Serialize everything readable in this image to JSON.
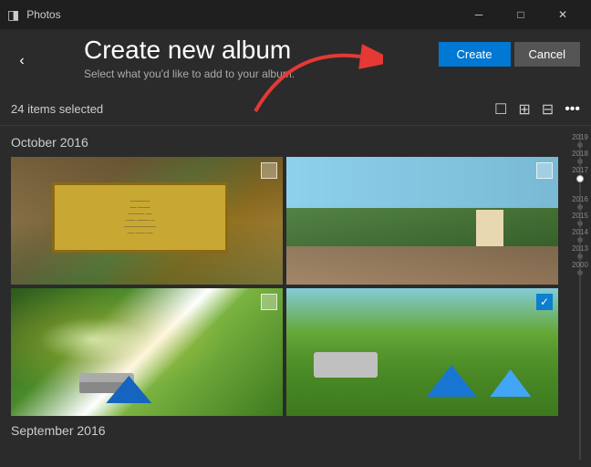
{
  "titlebar": {
    "app_name": "Photos",
    "minimize_label": "─",
    "maximize_label": "□",
    "close_label": "✕"
  },
  "header": {
    "title": "Create new album",
    "subtitle": "Select what you'd like to add to your album.",
    "create_button": "Create",
    "cancel_button": "Cancel"
  },
  "toolbar": {
    "selected_count": "24 items selected",
    "more_options": "•••"
  },
  "date_sections": [
    {
      "label": "October 2016"
    },
    {
      "label": "September 2016"
    }
  ],
  "timeline": {
    "years": [
      {
        "year": "2019",
        "active": false
      },
      {
        "year": "2018",
        "active": false
      },
      {
        "year": "2017",
        "active": true
      },
      {
        "year": "2016",
        "active": false
      },
      {
        "year": "2015",
        "active": false
      },
      {
        "year": "2014",
        "active": false
      },
      {
        "year": "2013",
        "active": false
      },
      {
        "year": "2000",
        "active": false
      }
    ]
  },
  "photos": {
    "row1": [
      {
        "id": "photo-1",
        "checked": false,
        "description": "Sign board in forest"
      },
      {
        "id": "photo-2",
        "checked": false,
        "description": "Trees and building"
      }
    ],
    "row2": [
      {
        "id": "photo-3",
        "checked": false,
        "description": "Camping with sunlight"
      },
      {
        "id": "photo-4",
        "checked": true,
        "description": "Camping with tents and car"
      }
    ]
  },
  "view_icons": {
    "checkbox_icon": "☐",
    "grid_icon": "⊞",
    "detail_icon": "≡"
  }
}
